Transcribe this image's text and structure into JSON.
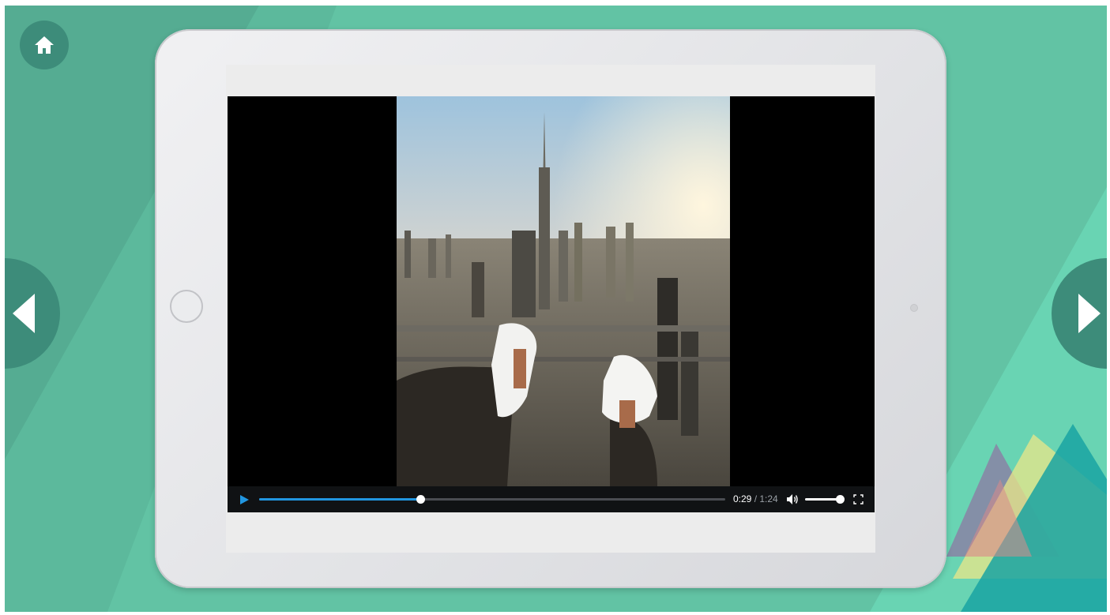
{
  "app": {
    "accent_color": "#5fc1a2",
    "dark_accent_color": "#3d8c7a"
  },
  "navigation": {
    "home_icon": "home-icon",
    "prev_icon": "chevron-left-icon",
    "next_icon": "chevron-right-icon"
  },
  "player": {
    "current_time": "0:29",
    "separator": " / ",
    "duration": "1:24",
    "progress_fraction": 0.345,
    "volume_fraction": 1.0,
    "progress_color": "#2196e0",
    "play_icon": "play-icon",
    "volume_icon": "volume-icon",
    "fullscreen_icon": "fullscreen-icon"
  },
  "video_still": {
    "description_icon": "city-skyline-image"
  }
}
